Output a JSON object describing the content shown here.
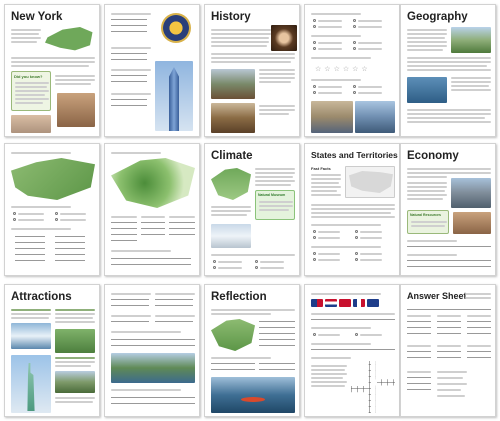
{
  "pages": [
    {
      "id": "p1",
      "title": "New York",
      "callout": "Did you know?"
    },
    {
      "id": "p2",
      "title": ""
    },
    {
      "id": "p3",
      "title": "History"
    },
    {
      "id": "p4",
      "title": ""
    },
    {
      "id": "p5",
      "title": "Geography"
    },
    {
      "id": "p6",
      "title": ""
    },
    {
      "id": "p7",
      "title": "Climate",
      "callout": "Natural Museum"
    },
    {
      "id": "p8",
      "title": "States and Territories",
      "sub": "Fast Facts"
    },
    {
      "id": "p9",
      "title": "Economy",
      "callout": "Natural Resources"
    },
    {
      "id": "p10",
      "title": "Attractions"
    },
    {
      "id": "p11",
      "title": ""
    },
    {
      "id": "p12",
      "title": "Reflection"
    },
    {
      "id": "p13",
      "title": ""
    },
    {
      "id": "p14",
      "title": "Answer Sheet"
    },
    {
      "id": "p15",
      "title": ""
    },
    {
      "id": "p16",
      "title": ""
    }
  ]
}
